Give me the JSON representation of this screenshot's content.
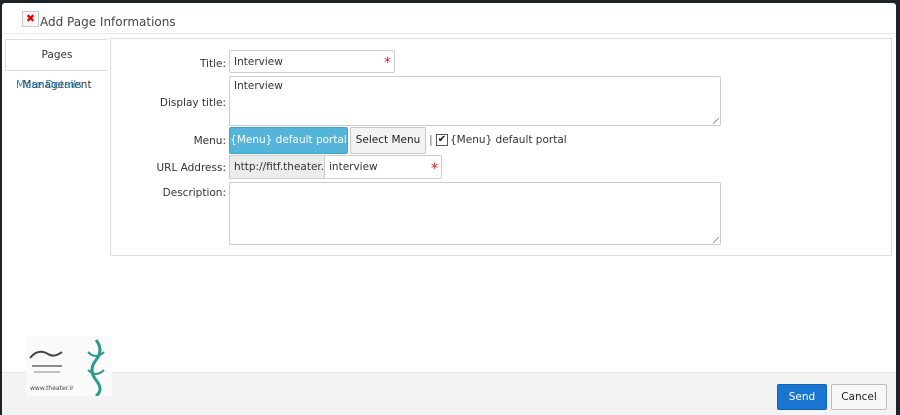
{
  "dialog": {
    "title": "Add Page Informations",
    "close_glyph": "✖"
  },
  "tabs": {
    "active_label": "Pages Management",
    "link_label": "More Details"
  },
  "form": {
    "title_label": "Title:",
    "title_value": "Interview",
    "display_title_label": "Display title:",
    "display_title_value": "Interview",
    "menu_label": "Menu:",
    "menu_button": "{Menu} default portal",
    "select_menu_button": "Select Menu",
    "separator": "|",
    "menu_checkbox_label": "{Menu} default portal",
    "menu_checkbox_checked": true,
    "url_label": "URL Address:",
    "url_prefix": "http://fitf.theater.ir/",
    "url_value": "interview",
    "description_label": "Description:",
    "description_value": "",
    "required_mark": "*"
  },
  "footer": {
    "send_label": "Send",
    "cancel_label": "Cancel"
  },
  "watermark": {
    "url_text": "www.theater.ir"
  },
  "colors": {
    "menu_button_bg": "#55b4da",
    "send_button_bg": "#1a75d1",
    "link": "#2a87c8",
    "required": "#e02020"
  }
}
